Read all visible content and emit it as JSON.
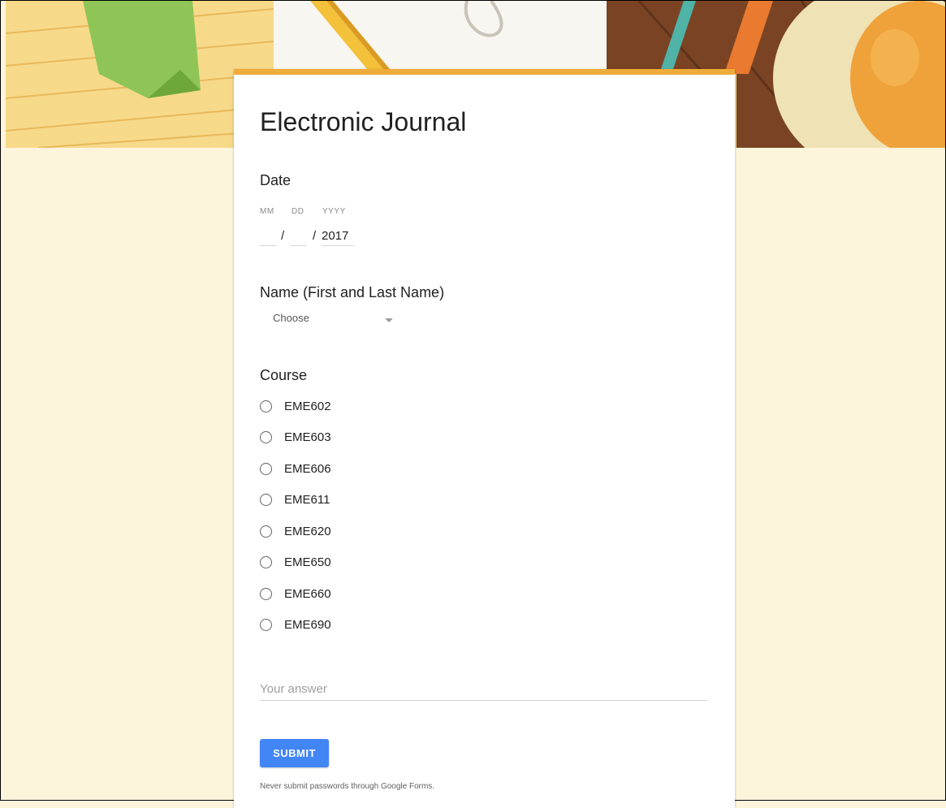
{
  "form": {
    "title": "Electronic Journal",
    "accent_color": "#f0ac3a",
    "background_color": "#fdf4dc"
  },
  "date_question": {
    "title": "Date",
    "month_label": "MM",
    "day_label": "DD",
    "year_label": "YYYY",
    "month_value": "",
    "day_value": "",
    "year_value": "2017",
    "separator": "/"
  },
  "name_question": {
    "title": "Name (First and Last Name)",
    "selected": "Choose"
  },
  "course_question": {
    "title": "Course",
    "options": [
      "EME602",
      "EME603",
      "EME606",
      "EME611",
      "EME620",
      "EME650",
      "EME660",
      "EME690"
    ]
  },
  "answer": {
    "placeholder": "Your answer",
    "value": ""
  },
  "submit": {
    "label": "SUBMIT",
    "color": "#4285f4"
  },
  "footer": {
    "note": "Never submit passwords through Google Forms."
  }
}
